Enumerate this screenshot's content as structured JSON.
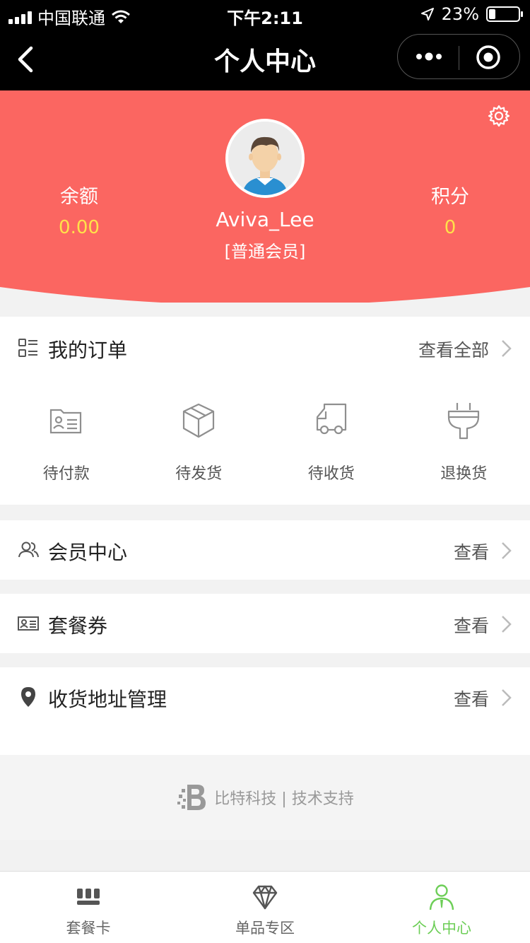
{
  "status_bar": {
    "carrier": "中国联通",
    "time": "下午2:11",
    "battery_percent": "23%",
    "battery_level": 0.23
  },
  "nav": {
    "title": "个人中心"
  },
  "profile": {
    "balance_label": "余额",
    "balance_value": "0.00",
    "points_label": "积分",
    "points_value": "0",
    "username": "Aviva_Lee",
    "member_level": "[普通会员]"
  },
  "orders": {
    "title": "我的订单",
    "view_all": "查看全部",
    "items": [
      {
        "label": "待付款",
        "icon": "card-icon"
      },
      {
        "label": "待发货",
        "icon": "box-icon"
      },
      {
        "label": "待收货",
        "icon": "truck-icon"
      },
      {
        "label": "退换货",
        "icon": "plug-icon"
      }
    ]
  },
  "menu": [
    {
      "title": "会员中心",
      "link": "查看",
      "icon": "members-icon"
    },
    {
      "title": "套餐券",
      "link": "查看",
      "icon": "coupon-icon"
    },
    {
      "title": "收货地址管理",
      "link": "查看",
      "icon": "location-pin-icon"
    }
  ],
  "footer": {
    "support_text": "比特科技 | 技术支持"
  },
  "tabbar": [
    {
      "label": "套餐卡",
      "icon": "package-card-icon",
      "active": false
    },
    {
      "label": "单品专区",
      "icon": "diamond-icon",
      "active": false
    },
    {
      "label": "个人中心",
      "icon": "person-icon",
      "active": true
    }
  ],
  "colors": {
    "header_bg": "#fb6661",
    "value_yellow": "#ffe14a",
    "active_green": "#6dce57"
  }
}
